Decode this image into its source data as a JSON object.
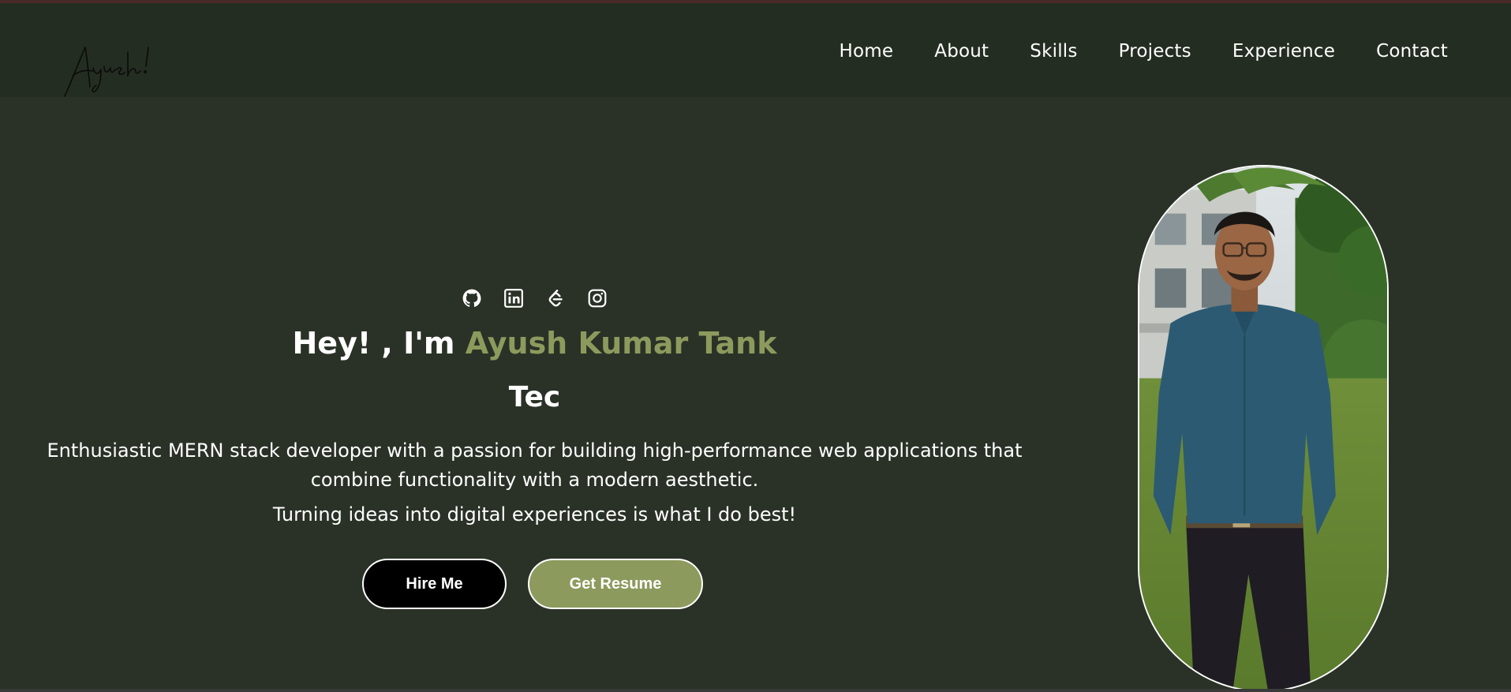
{
  "colors": {
    "background": "#2a3227",
    "navbar": "#242d21",
    "accent": "#8c9a5d",
    "text": "#ffffff",
    "hire_button": "#000000"
  },
  "header": {
    "logo_text": "Ayush!",
    "nav": [
      "Home",
      "About",
      "Skills",
      "Projects",
      "Experience",
      "Contact"
    ]
  },
  "hero": {
    "socials": [
      "github-icon",
      "linkedin-icon",
      "leetcode-icon",
      "instagram-icon"
    ],
    "greeting": "Hey! , I'm",
    "name": "Ayush Kumar Tank",
    "typed_text": "Tec",
    "bio": "Enthusiastic MERN stack developer with a passion for building high-performance web applications that combine functionality with a modern aesthetic.",
    "tagline": "Turning ideas into digital experiences is what I do best!",
    "hire_label": "Hire Me",
    "resume_label": "Get Resume"
  }
}
